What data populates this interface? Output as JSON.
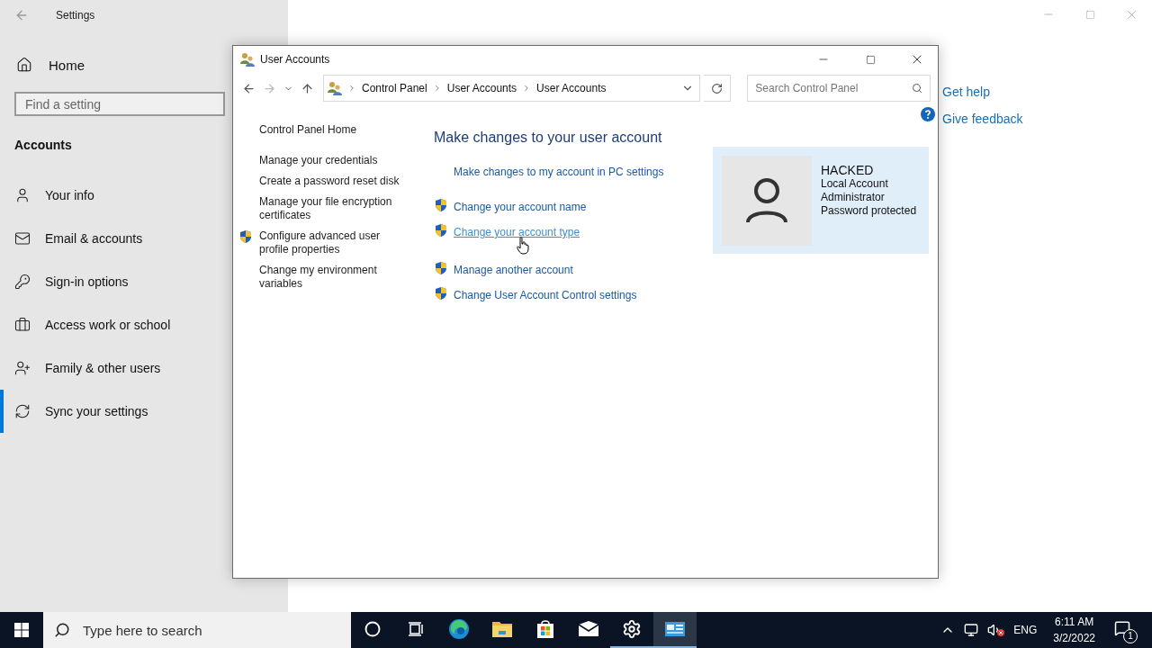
{
  "settings_window": {
    "title": "Settings",
    "home": "Home",
    "search": {
      "placeholder": "Find a setting"
    },
    "section": "Accounts",
    "nav": [
      {
        "kind": "info",
        "label": "Your info",
        "selected": false
      },
      {
        "kind": "mail",
        "label": "Email & accounts",
        "selected": false
      },
      {
        "kind": "key",
        "label": "Sign-in options",
        "selected": false
      },
      {
        "kind": "briefcase",
        "label": "Access work or school",
        "selected": false
      },
      {
        "kind": "family",
        "label": "Family & other users",
        "selected": false
      },
      {
        "kind": "sync",
        "label": "Sync your settings",
        "selected": true
      }
    ],
    "help_links": [
      "Get help",
      "Give feedback"
    ]
  },
  "control_panel": {
    "title": "User Accounts",
    "breadcrumb": [
      "Control Panel",
      "User Accounts",
      "User Accounts"
    ],
    "search": {
      "placeholder": "Search Control Panel"
    },
    "sidebar": {
      "home": "Control Panel Home",
      "tasks": [
        {
          "label": "Manage your credentials",
          "shield": false
        },
        {
          "label": "Create a password reset disk",
          "shield": false
        },
        {
          "label": "Manage your file encryption certificates",
          "shield": false
        },
        {
          "label": "Configure advanced user profile properties",
          "shield": true
        },
        {
          "label": "Change my environment variables",
          "shield": false
        }
      ]
    },
    "heading": "Make changes to your user account",
    "link_groups": [
      [
        {
          "label": "Make changes to my account in PC settings",
          "shield": false,
          "hovered": false
        }
      ],
      [
        {
          "label": "Change your account name",
          "shield": true,
          "hovered": false
        },
        {
          "label": "Change your account type",
          "shield": true,
          "hovered": true
        }
      ],
      [
        {
          "label": "Manage another account",
          "shield": true,
          "hovered": false
        },
        {
          "label": "Change User Account Control settings",
          "shield": true,
          "hovered": false
        }
      ]
    ],
    "account": {
      "name": "HACKED",
      "details": [
        "Local Account",
        "Administrator",
        "Password protected"
      ]
    }
  },
  "taskbar": {
    "search": {
      "placeholder": "Type here to search"
    },
    "apps": [
      {
        "kind": "cortana",
        "running": false,
        "selected": false
      },
      {
        "kind": "taskview",
        "running": false,
        "selected": false
      },
      {
        "kind": "edge",
        "running": false,
        "selected": false
      },
      {
        "kind": "explorer",
        "running": false,
        "selected": false
      },
      {
        "kind": "store",
        "running": false,
        "selected": false
      },
      {
        "kind": "mail",
        "running": false,
        "selected": false
      },
      {
        "kind": "settings",
        "running": true,
        "selected": false
      },
      {
        "kind": "controlpanel",
        "running": true,
        "selected": true
      }
    ],
    "language": "ENG",
    "time": "6:11 AM",
    "date": "3/2/2022",
    "notifications": "1"
  }
}
